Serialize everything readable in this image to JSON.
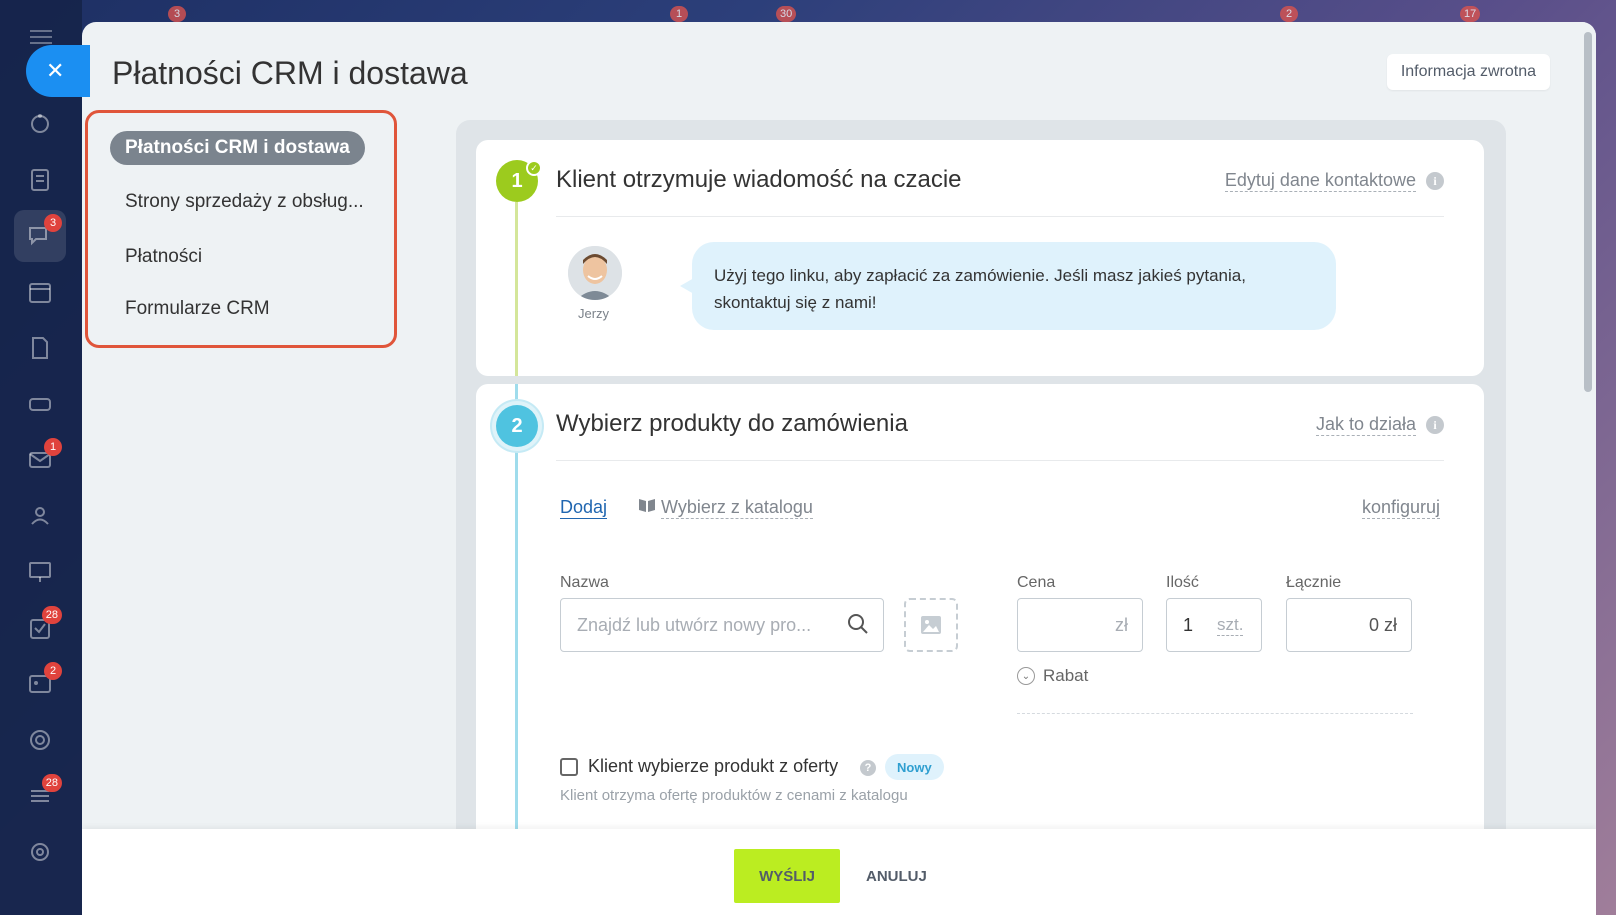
{
  "header": {
    "title": "Płatności CRM i dostawa",
    "feedback_label": "Informacja zwrotna"
  },
  "rail": {
    "items": [
      {
        "icon": "robot-icon",
        "badge": ""
      },
      {
        "icon": "feed-icon",
        "badge": ""
      },
      {
        "icon": "chat-icon",
        "badge": "3"
      },
      {
        "icon": "calendar-icon",
        "badge": ""
      },
      {
        "icon": "document-icon",
        "badge": ""
      },
      {
        "icon": "drive-icon",
        "badge": ""
      },
      {
        "icon": "mail-icon",
        "badge": "1"
      },
      {
        "icon": "contacts-icon",
        "badge": ""
      },
      {
        "icon": "board-icon",
        "badge": ""
      },
      {
        "icon": "tasks-icon",
        "badge": "28"
      },
      {
        "icon": "crm-icon",
        "badge": "2"
      },
      {
        "icon": "target-icon",
        "badge": ""
      },
      {
        "icon": "list-icon",
        "badge": "28"
      },
      {
        "icon": "settings-icon",
        "badge": ""
      }
    ],
    "top_badges": [
      "3",
      "1",
      "30",
      "2",
      "17"
    ]
  },
  "menu": {
    "items": [
      {
        "label": "Płatności CRM i dostawa",
        "active": true
      },
      {
        "label": "Strony sprzedaży z obsług...",
        "active": false
      },
      {
        "label": "Płatności",
        "active": false
      },
      {
        "label": "Formularze CRM",
        "active": false
      }
    ]
  },
  "step1": {
    "number": "1",
    "title": "Klient otrzymuje wiadomość na czacie",
    "link": "Edytuj dane kontaktowe",
    "avatar_name": "Jerzy",
    "message": "Użyj tego linku, aby zapłacić za zamówienie. Jeśli masz jakieś pytania, skontaktuj się z nami!"
  },
  "step2": {
    "number": "2",
    "title": "Wybierz produkty do zamówienia",
    "link": "Jak to działa",
    "add_label": "Dodaj",
    "catalog_label": "Wybierz z katalogu",
    "configure_label": "konfiguruj",
    "name_label": "Nazwa",
    "name_placeholder": "Znajdź lub utwórz nowy pro...",
    "price_label": "Cena",
    "price_currency": "zł",
    "qty_label": "Ilość",
    "qty_value": "1",
    "qty_unit": "szt.",
    "total_label": "Łącznie",
    "total_value": "0 zł",
    "discount_label": "Rabat",
    "offer_checkbox_label": "Klient wybierze produkt z oferty",
    "new_badge": "Nowy",
    "offer_hint": "Klient otrzyma ofertę produktów z cenami z katalogu"
  },
  "footer": {
    "send_label": "WYŚLIJ",
    "cancel_label": "ANULUJ"
  },
  "colors": {
    "accent_blue": "#1b8ff2",
    "step1_green": "#9ccb1e",
    "step2_cyan": "#4fc3e0",
    "send_button": "#bbed21",
    "menu_highlight": "#e0553a"
  }
}
